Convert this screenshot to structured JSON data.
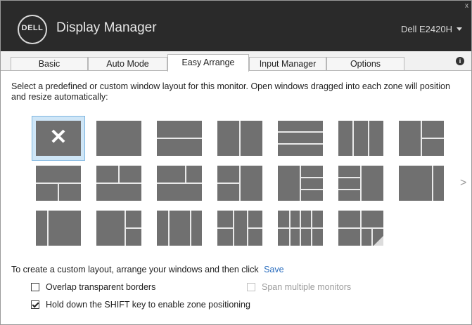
{
  "header": {
    "logo_text": "DELL",
    "app_title": "Display Manager",
    "monitor_name": "Dell E2420H",
    "close_glyph": "x"
  },
  "tabs": [
    {
      "label": "Basic"
    },
    {
      "label": "Auto Mode"
    },
    {
      "label": "Easy Arrange"
    },
    {
      "label": "Input Manager"
    },
    {
      "label": "Options"
    }
  ],
  "active_tab": "Easy Arrange",
  "info_icon": "i",
  "instructions": "Select a predefined or custom window layout for this monitor.  Open windows dragged into each zone will position and resize automatically:",
  "layouts": {
    "selected_index": 0,
    "none_glyph": "✕",
    "next_glyph": ">",
    "count": 20
  },
  "custom_layout": {
    "text": "To create a custom layout, arrange your windows and then click",
    "save_label": "Save"
  },
  "options": [
    {
      "label": "Overlap transparent borders",
      "checked": false,
      "enabled": true
    },
    {
      "label": "Span multiple monitors",
      "checked": false,
      "enabled": false
    },
    {
      "label": "Hold down the SHIFT key to enable zone positioning",
      "checked": true,
      "enabled": true
    }
  ],
  "colors": {
    "titlebar": "#2a2a2a",
    "zone": "#707070",
    "selection": "#cfe6f7",
    "link": "#2d6fbf"
  }
}
